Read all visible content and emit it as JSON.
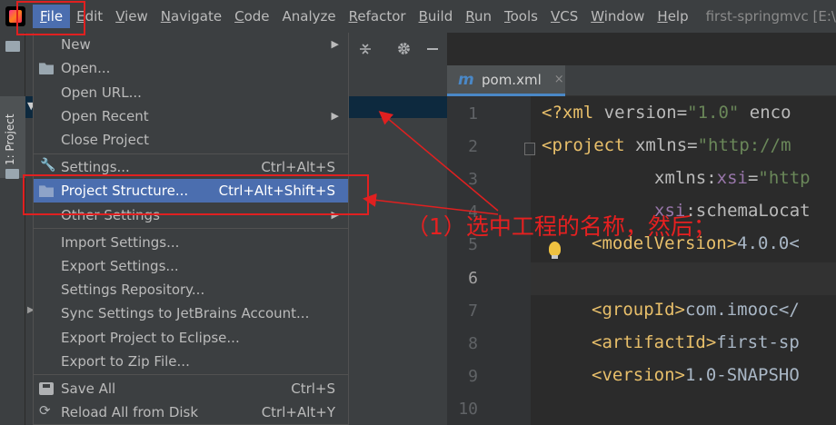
{
  "menubar": {
    "items": [
      {
        "label": "File",
        "u": "F",
        "rest": "ile"
      },
      {
        "label": "Edit",
        "u": "E",
        "rest": "dit"
      },
      {
        "label": "View",
        "u": "V",
        "rest": "iew"
      },
      {
        "label": "Navigate",
        "u": "N",
        "rest": "avigate"
      },
      {
        "label": "Code",
        "u": "C",
        "rest": "ode"
      },
      {
        "label": "Analyze",
        "u": "",
        "rest": "Analyze"
      },
      {
        "label": "Refactor",
        "u": "R",
        "rest": "efactor"
      },
      {
        "label": "Build",
        "u": "B",
        "rest": "uild"
      },
      {
        "label": "Run",
        "u": "R",
        "rest": "un"
      },
      {
        "label": "Tools",
        "u": "T",
        "rest": "ools"
      },
      {
        "label": "VCS",
        "u": "V",
        "rest": "CS"
      },
      {
        "label": "Window",
        "u": "W",
        "rest": "indow"
      },
      {
        "label": "Help",
        "u": "H",
        "rest": "elp"
      }
    ],
    "window_title": "first-springmvc [E:\\"
  },
  "sidebar": {
    "project_tab": "1: Project"
  },
  "editor": {
    "tab_label": "pom.xml",
    "tab_close": "×",
    "line_numbers": [
      "1",
      "2",
      "3",
      "4",
      "5",
      "6",
      "7",
      "8",
      "9",
      "10"
    ],
    "code": {
      "l1_pi": "<?xml ",
      "l1_attr": "version=",
      "l1_val": "\"1.0\"",
      "l1_rest": " enco",
      "l2_tag": "<project ",
      "l2_attr": "xmlns=",
      "l2_val": "\"http://m",
      "l3_attr": "xmlns:",
      "l3_ns": "xsi",
      "l3_eq": "=",
      "l3_val": "\"http",
      "l4_ns": "xsi",
      "l4_attr": ":schemaLocat",
      "l5_tag": "<modelVersion>",
      "l5_text": "4.0.0<",
      "l7_tag": "<groupId>",
      "l7_text": "com.imooc</",
      "l8_tag": "<artifactId>",
      "l8_text": "first-sp",
      "l9_tag": "<version>",
      "l9_text": "1.0-SNAPSHO"
    }
  },
  "file_menu": {
    "items": [
      {
        "label": "New",
        "shortcut": "",
        "submenu": true
      },
      {
        "label": "Open...",
        "shortcut": "",
        "submenu": false
      },
      {
        "label": "Open URL...",
        "shortcut": "",
        "submenu": false
      },
      {
        "label": "Open Recent",
        "shortcut": "",
        "submenu": true
      },
      {
        "label": "Close Project",
        "shortcut": "",
        "submenu": false
      },
      {
        "label": "Settings...",
        "shortcut": "Ctrl+Alt+S",
        "submenu": false
      },
      {
        "label": "Project Structure...",
        "shortcut": "Ctrl+Alt+Shift+S",
        "submenu": false,
        "selected": true
      },
      {
        "label": "Other Settings",
        "shortcut": "",
        "submenu": true
      },
      {
        "label": "Import Settings...",
        "shortcut": "",
        "submenu": false
      },
      {
        "label": "Export Settings...",
        "shortcut": "",
        "submenu": false
      },
      {
        "label": "Settings Repository...",
        "shortcut": "",
        "submenu": false
      },
      {
        "label": "Sync Settings to JetBrains Account...",
        "shortcut": "",
        "submenu": false
      },
      {
        "label": "Export Project to Eclipse...",
        "shortcut": "",
        "submenu": false
      },
      {
        "label": "Export to Zip File...",
        "shortcut": "",
        "submenu": false
      },
      {
        "label": "Save All",
        "shortcut": "Ctrl+S",
        "submenu": false
      },
      {
        "label": "Reload All from Disk",
        "shortcut": "Ctrl+Alt+Y",
        "submenu": false
      }
    ],
    "submenu_arrow": "▶"
  },
  "annotation": {
    "text": "（1）选中工程的名称，然后；"
  },
  "icons": [
    "folder-icon",
    "wrench-icon",
    "project-structure-icon",
    "save-icon",
    "reload-icon",
    "settings-gear-icon",
    "minimize-icon",
    "collapse-icon",
    "maven-icon",
    "bulb-icon"
  ],
  "colors": {
    "selection": "#4b6eaf",
    "annotation": "#e02020",
    "background": "#2b2b2b",
    "panel": "#3c3f41"
  }
}
